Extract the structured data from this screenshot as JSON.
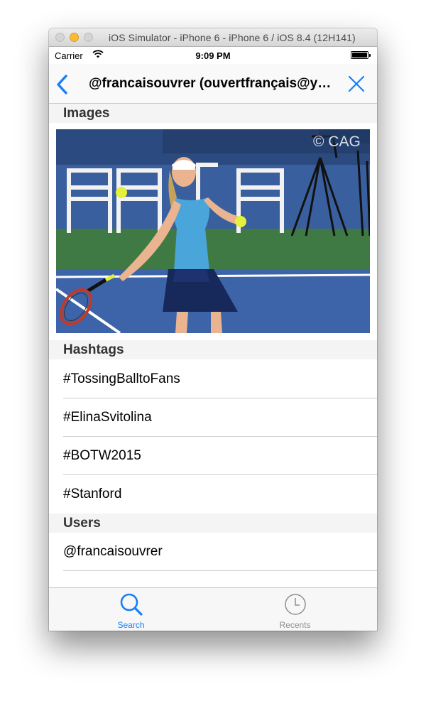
{
  "window": {
    "title": "iOS Simulator - iPhone 6 - iPhone 6 / iOS 8.4 (12H141)"
  },
  "status_bar": {
    "carrier": "Carrier",
    "time": "9:09 PM"
  },
  "nav_bar": {
    "title": "@francaisouvrer (ouvertfrançais@yahoo.fr)"
  },
  "sections": {
    "images": {
      "header": "Images",
      "watermark": "© CAG"
    },
    "hashtags": {
      "header": "Hashtags",
      "items": [
        "#TossingBalltoFans",
        "#ElinaSvitolina",
        "#BOTW2015",
        "#Stanford"
      ]
    },
    "users": {
      "header": "Users",
      "items": [
        "@francaisouvrer"
      ]
    }
  },
  "tab_bar": {
    "tabs": [
      {
        "label": "Search",
        "icon": "search-icon",
        "selected": true
      },
      {
        "label": "Recents",
        "icon": "clock-icon",
        "selected": false
      }
    ]
  },
  "colors": {
    "accent": "#1a7ef5",
    "inactive": "#8e8e93",
    "court_blue": "#3a5f9e",
    "court_green": "#3f7a45"
  }
}
